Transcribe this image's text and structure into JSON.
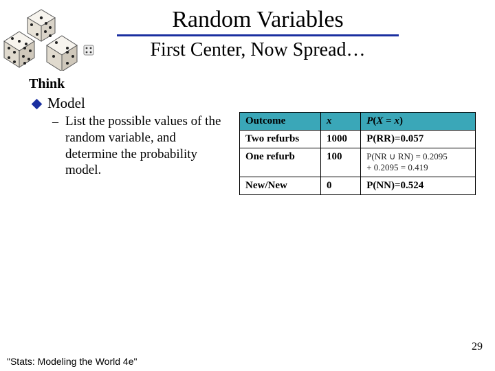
{
  "title": "Random Variables",
  "subtitle": "First Center, Now Spread…",
  "think_label": "Think",
  "bullet1": "Model",
  "sub_bullet": "List the possible values of the random variable, and determine the probability model.",
  "table": {
    "headers": {
      "outcome": "Outcome",
      "x": "x",
      "px": "P(X = x)"
    },
    "rows": [
      {
        "outcome": "Two refurbs",
        "x": "1000",
        "px": "P(RR)=0.057"
      },
      {
        "outcome": "One refurb",
        "x": "100",
        "px_line1": "P(NR ∪ RN) = 0.2095",
        "px_line2": "+ 0.2095 = 0.419"
      },
      {
        "outcome": "New/New",
        "x": "0",
        "px": "P(NN)=0.524"
      }
    ]
  },
  "page_number": "29",
  "footer": "\"Stats: Modeling the World 4e\"",
  "chart_data": {
    "type": "table",
    "title": "Probability model for refund random variable X",
    "columns": [
      "Outcome",
      "x",
      "P(X = x)"
    ],
    "rows": [
      [
        "Two refurbs",
        1000,
        0.057
      ],
      [
        "One refurb",
        100,
        0.419
      ],
      [
        "New/New",
        0,
        0.524
      ]
    ],
    "notes": "P(one refurb) = P(NR ∪ RN) = 0.2095 + 0.2095 = 0.419"
  }
}
